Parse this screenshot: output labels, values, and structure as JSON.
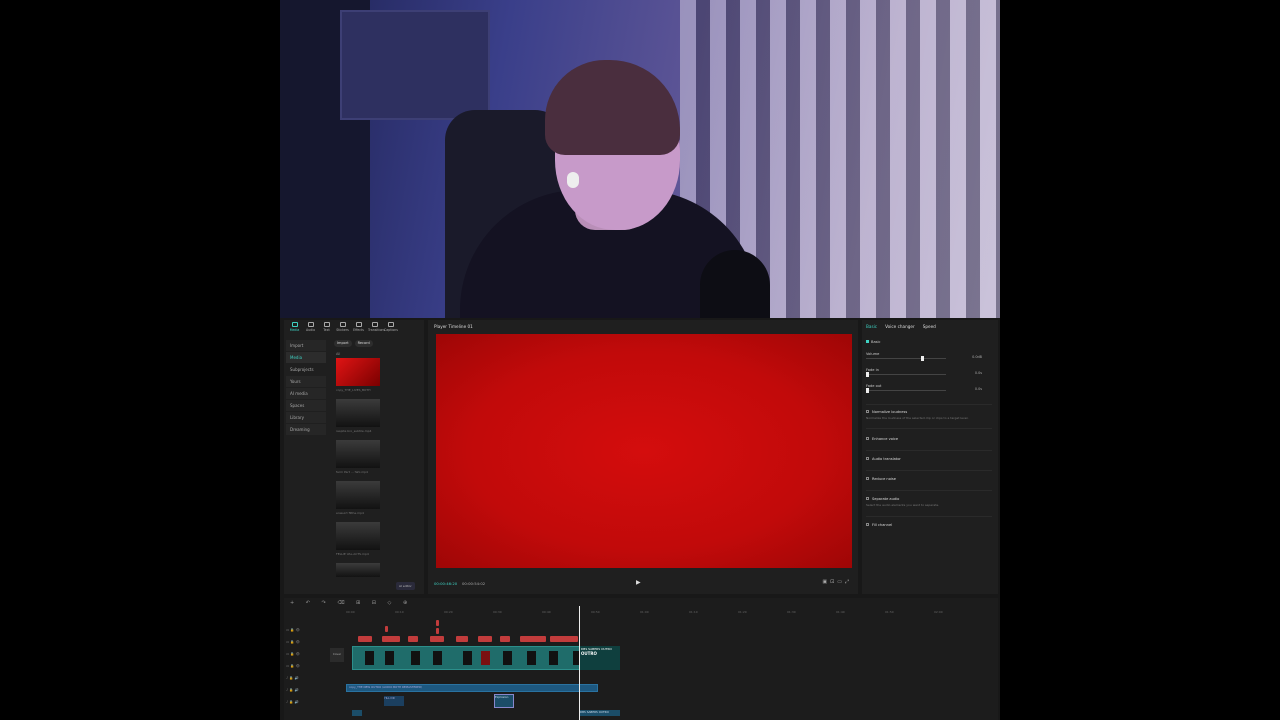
{
  "left_panel": {
    "tabs": [
      {
        "label": "Media",
        "icon": "media-icon"
      },
      {
        "label": "Audio",
        "icon": "audio-icon"
      },
      {
        "label": "Text",
        "icon": "text-icon"
      },
      {
        "label": "Stickers",
        "icon": "stickers-icon"
      },
      {
        "label": "Effects",
        "icon": "effects-icon"
      },
      {
        "label": "Transitions",
        "icon": "transitions-icon"
      },
      {
        "label": "Captions",
        "icon": "captions-icon"
      }
    ],
    "sidebar": [
      "Import",
      "Media",
      "Subprojects",
      "Yours",
      "AI media",
      "Spaces",
      "Library",
      "Dreaming"
    ],
    "buttons": {
      "import": "Import",
      "record": "Record"
    },
    "filter_label": "All",
    "ai_button": "AI editor",
    "thumbnails": [
      {
        "caption": "copy_THE_LIVES_BOTH",
        "badge": ""
      },
      {
        "caption": "respite bro_subtile.mp4",
        "badge": "Added"
      },
      {
        "caption": "farm Part ... fahl.mp4",
        "badge": ""
      },
      {
        "caption": "erasuirt filthe.mp4",
        "badge": "Added"
      },
      {
        "caption": "FELLIE VAL.ACTS.mp4",
        "badge": "Added"
      },
      {
        "caption": "",
        "badge": ""
      }
    ]
  },
  "player": {
    "title": "Player Timeline 01",
    "timecode_current": "00:00:46:20",
    "timecode_total": "00:00:54:02",
    "canvas_color": "#c80b0b"
  },
  "right_panel": {
    "tabs": [
      "Basic",
      "Voice changer",
      "Speed"
    ],
    "section": "Basic",
    "controls": [
      {
        "label": "Volume",
        "value": "0.0dB",
        "level": 0.72
      },
      {
        "label": "Fade in",
        "value": "0.0s",
        "level": 0.0
      },
      {
        "label": "Fade out",
        "value": "0.0s",
        "level": 0.0
      }
    ],
    "features": [
      {
        "label": "Normalize loudness",
        "desc": "Normalize the loudness of the selected clip or clips to a target level."
      },
      {
        "label": "Enhance voice",
        "desc": ""
      },
      {
        "label": "Audio translator",
        "desc": ""
      },
      {
        "label": "Reduce noise",
        "desc": ""
      },
      {
        "label": "Separate audio",
        "desc": "Select the audio elements you want to separate."
      },
      {
        "label": "Fill channel",
        "desc": ""
      }
    ]
  },
  "timeline": {
    "ruler": [
      "00:00",
      "00:10",
      "00:20",
      "00:30",
      "00:40",
      "00:50",
      "01:00",
      "01:10",
      "01:20",
      "01:30",
      "01:40",
      "01:50",
      "02:00"
    ],
    "cover_label": "Cover",
    "video_title_clip": "DBS SABERS OUTRO",
    "video_title_clip_text": "OUTRO",
    "audio_clip": "copy_THE NEW OUTRO (AUDIO BOTH REMASTERED)",
    "sub_clip_1": "YILL DR",
    "sub_clip_2": "Explosion",
    "sub_clip_3": "DBS SABERS OUTRO"
  }
}
